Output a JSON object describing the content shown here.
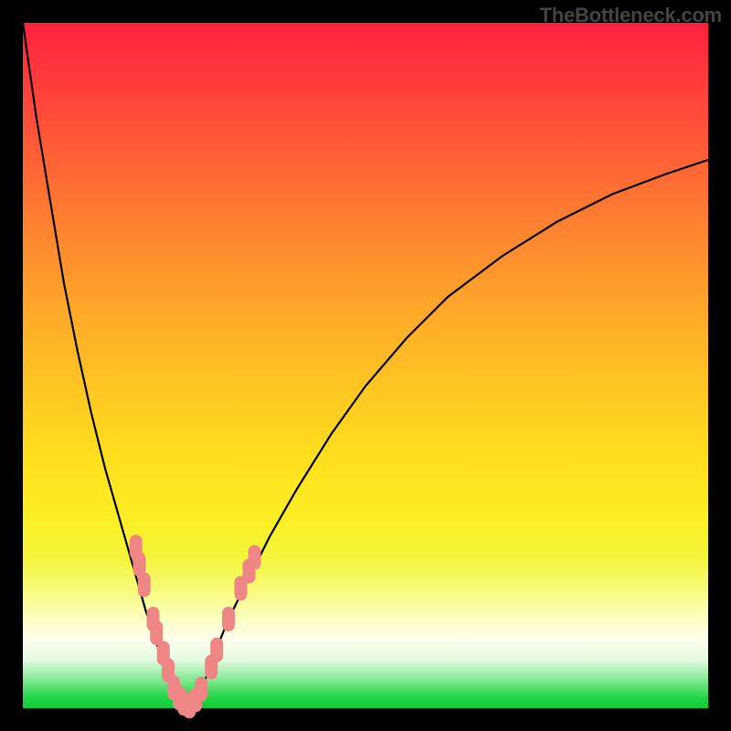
{
  "watermark": "TheBottleneck.com",
  "colors": {
    "curve_stroke": "#000000",
    "marker_fill": "#ef8686",
    "marker_stroke": "#ef8686"
  },
  "chart_data": {
    "type": "line",
    "title": "",
    "xlabel": "",
    "ylabel": "",
    "xlim": [
      0,
      100
    ],
    "ylim": [
      0,
      100
    ],
    "series": [
      {
        "name": "curve-left",
        "x": [
          0,
          2,
          4,
          6,
          8,
          10,
          12,
          14,
          16,
          18,
          20,
          22,
          23,
          24
        ],
        "values": [
          100,
          86,
          74,
          62,
          52,
          43,
          35,
          28,
          21,
          14,
          8,
          3,
          1,
          0
        ]
      },
      {
        "name": "curve-right",
        "x": [
          24,
          25,
          26,
          27,
          28,
          30,
          33,
          36,
          40,
          45,
          50,
          56,
          62,
          70,
          78,
          86,
          94,
          100
        ],
        "values": [
          0,
          1,
          3,
          5,
          8,
          13,
          19,
          25,
          32,
          40,
          47,
          54,
          60,
          66,
          71,
          75,
          78,
          80
        ]
      }
    ],
    "markers": [
      {
        "x": 16.5,
        "y": 23.5
      },
      {
        "x": 17.0,
        "y": 21.0
      },
      {
        "x": 17.7,
        "y": 18.0
      },
      {
        "x": 19.0,
        "y": 13.0
      },
      {
        "x": 19.5,
        "y": 11.0
      },
      {
        "x": 20.5,
        "y": 8.0
      },
      {
        "x": 21.2,
        "y": 5.5
      },
      {
        "x": 22.0,
        "y": 3.0
      },
      {
        "x": 22.8,
        "y": 1.5
      },
      {
        "x": 23.5,
        "y": 0.7
      },
      {
        "x": 24.3,
        "y": 0.3
      },
      {
        "x": 25.2,
        "y": 1.2
      },
      {
        "x": 26.0,
        "y": 2.8
      },
      {
        "x": 27.5,
        "y": 6.0
      },
      {
        "x": 28.3,
        "y": 8.5
      },
      {
        "x": 30.0,
        "y": 13.0
      },
      {
        "x": 31.8,
        "y": 17.5
      },
      {
        "x": 33.0,
        "y": 20.0
      },
      {
        "x": 33.8,
        "y": 22.0
      }
    ]
  }
}
